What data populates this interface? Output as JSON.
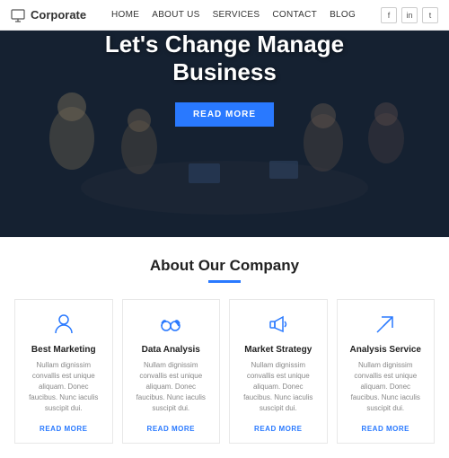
{
  "header": {
    "logo_text": "Corporate",
    "nav_items": [
      "HOME",
      "ABOUT US",
      "SERVICES",
      "CONTACT",
      "BLOG"
    ],
    "social_items": [
      "f",
      "in",
      "t"
    ]
  },
  "hero": {
    "title_line1": "Let's Change Manage",
    "title_line2": "Business",
    "btn_label": "READ MORE"
  },
  "about": {
    "section_title": "About Our Company",
    "cards": [
      {
        "id": "best-marketing",
        "icon": "person",
        "title": "Best Marketing",
        "text": "Nullam dignissim convallis est unique aliquam. Donec faucibus. Nunc iaculis suscipit dui.",
        "link": "READ MORE"
      },
      {
        "id": "data-analysis",
        "icon": "glasses",
        "title": "Data Analysis",
        "text": "Nullam dignissim convallis est unique aliquam. Donec faucibus. Nunc iaculis suscipit dui.",
        "link": "READ MORE"
      },
      {
        "id": "market-strategy",
        "icon": "speaker",
        "title": "Market Strategy",
        "text": "Nullam dignissim convallis est unique aliquam. Donec faucibus. Nunc iaculis suscipit dui.",
        "link": "READ MORE"
      },
      {
        "id": "analysis-service",
        "icon": "arrow",
        "title": "Analysis Service",
        "text": "Nullam dignissim convallis est unique aliquam. Donec faucibus. Nunc iaculis suscipit dui.",
        "link": "READ MORE"
      }
    ]
  }
}
